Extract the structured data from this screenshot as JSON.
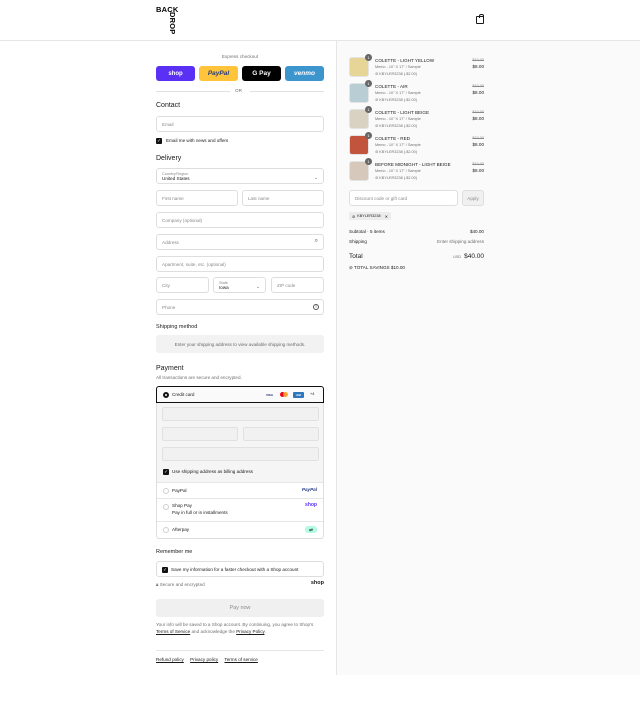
{
  "brand": {
    "logo_line1": "BACK",
    "logo_line2": "DROP"
  },
  "express": {
    "label": "Express checkout",
    "buttons": [
      {
        "label": "shop",
        "color": "#5a31f4"
      },
      {
        "label": "PayPal",
        "color": "#ffc439"
      },
      {
        "label": "G Pay",
        "color": "#000000"
      },
      {
        "label": "venmo",
        "color": "#3d95ce"
      }
    ],
    "or": "OR"
  },
  "contact": {
    "heading": "Contact",
    "email_placeholder": "Email",
    "news_label": "Email me with news and offers"
  },
  "delivery": {
    "heading": "Delivery",
    "country_label": "Country/Region",
    "country_value": "United States",
    "first_name": "First name",
    "last_name": "Last name",
    "company": "Company (optional)",
    "address": "Address",
    "apartment": "Apartment, suite, etc. (optional)",
    "city": "City",
    "state_label": "State",
    "state_value": "Iowa",
    "zip": "ZIP code",
    "phone": "Phone"
  },
  "shipping": {
    "heading": "Shipping method",
    "info": "Enter your shipping address to view available shipping methods."
  },
  "payment": {
    "heading": "Payment",
    "subtitle": "All transactions are secure and encrypted.",
    "credit_card": "Credit card",
    "card_more": "+4",
    "billing_label": "Use shipping address as billing address",
    "paypal": "PayPal",
    "paypal_logo": "PayPal",
    "shoppay": "Shop Pay",
    "shoppay_sub": "Pay in full or in installments",
    "shoppay_logo": "shop",
    "afterpay": "Afterpay"
  },
  "remember": {
    "heading": "Remember me",
    "label": "Save my information for a faster checkout with a Shop account",
    "secure": "Secure and encrypted",
    "shop_logo": "shop"
  },
  "pay_now": "Pay now",
  "legal": {
    "text1": "Your info will be saved to a Shop account. By continuing, you agree to Shop's",
    "terms": "Terms of Service",
    "text2": "and acknowledge the",
    "privacy": "Privacy Policy",
    "text3": "."
  },
  "footer_links": [
    "Refund policy",
    "Privacy policy",
    "Terms of service"
  ],
  "order": {
    "items": [
      {
        "qty": "1",
        "name": "COLETTE - LIGHT YELLOW",
        "variant": "Memo - 10\" X 17\" / Sample",
        "discount": "KBYLER3238 (-$2.00)",
        "old_price": "$10.00",
        "price": "$8.00",
        "color": "#e6d596"
      },
      {
        "qty": "1",
        "name": "COLETTE - AIR",
        "variant": "Memo - 10\" X 17\" / Sample",
        "discount": "KBYLER3238 (-$2.00)",
        "old_price": "$10.00",
        "price": "$8.00",
        "color": "#b9cdd4"
      },
      {
        "qty": "1",
        "name": "COLETTE - LIGHT BEIGE",
        "variant": "Memo - 10\" X 17\" / Sample",
        "discount": "KBYLER3238 (-$2.00)",
        "old_price": "$10.00",
        "price": "$8.00",
        "color": "#d9d2c2"
      },
      {
        "qty": "1",
        "name": "COLETTE - RED",
        "variant": "Memo - 10\" X 17\" / Sample",
        "discount": "KBYLER3238 (-$2.00)",
        "old_price": "$10.00",
        "price": "$8.00",
        "color": "#c2533d"
      },
      {
        "qty": "1",
        "name": "BEFORE MIDNIGHT - LIGHT BEIGE",
        "variant": "Memo - 10\" X 17\" / Sample",
        "discount": "KBYLER3238 (-$2.00)",
        "old_price": "$10.00",
        "price": "$8.00",
        "color": "#d6c9bb"
      }
    ],
    "discount_placeholder": "Discount code or gift card",
    "apply": "Apply",
    "applied_code": "KBYLER3238",
    "subtotal_label": "Subtotal · 5 items",
    "subtotal_value": "$40.00",
    "shipping_label": "Shipping",
    "shipping_value": "Enter shipping address",
    "total_label": "Total",
    "currency": "USD",
    "total_value": "$40.00",
    "savings_label": "TOTAL SAVINGS",
    "savings_value": "$10.00"
  }
}
